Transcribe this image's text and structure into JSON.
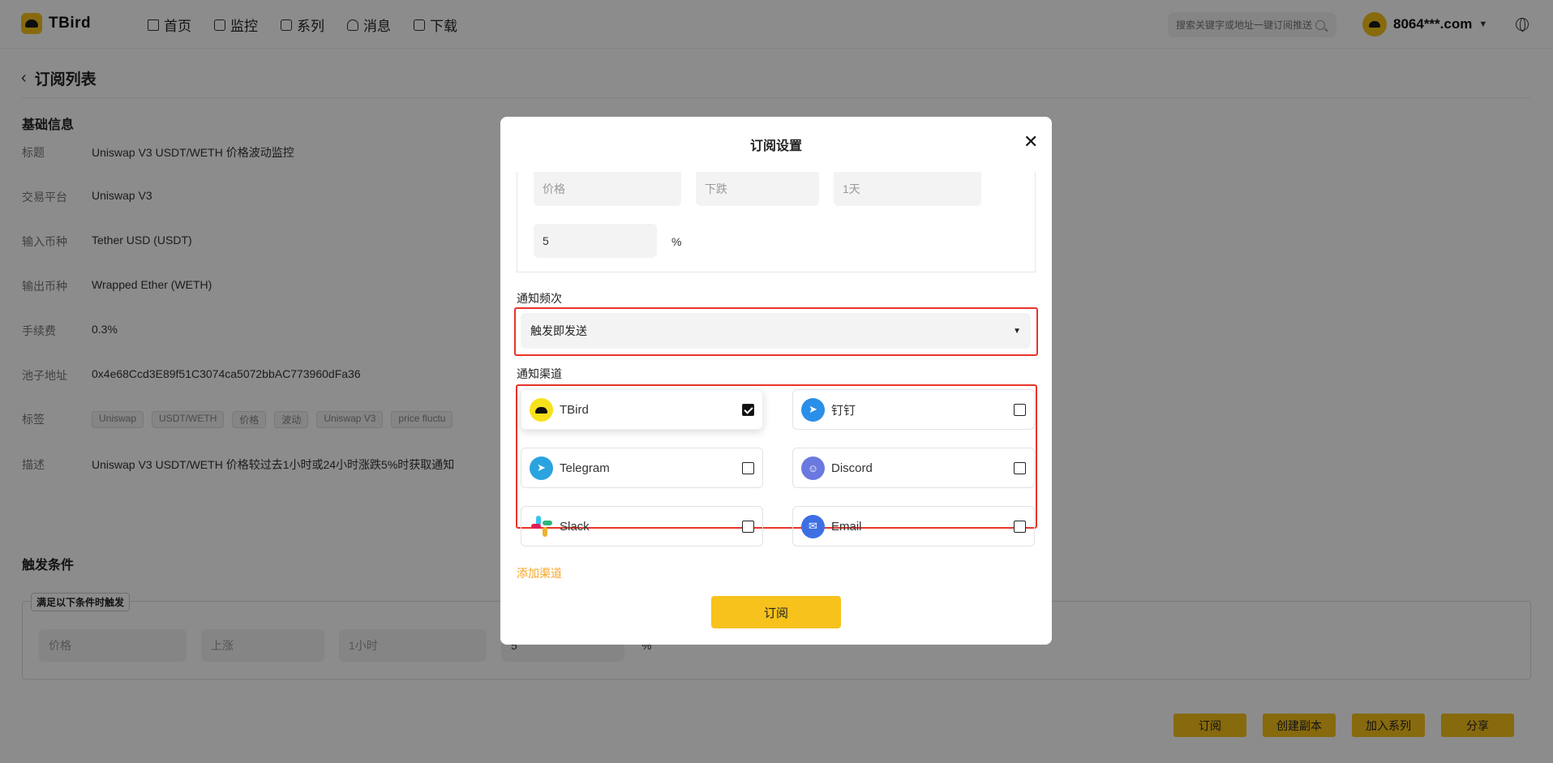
{
  "app": {
    "name": "TBird"
  },
  "nav": [
    {
      "label": "首页",
      "icon": "home-icon"
    },
    {
      "label": "监控",
      "icon": "monitor-icon"
    },
    {
      "label": "系列",
      "icon": "series-icon"
    },
    {
      "label": "消息",
      "icon": "bell-icon"
    },
    {
      "label": "下载",
      "icon": "download-icon"
    }
  ],
  "search": {
    "placeholder": "搜索关键字或地址一键订阅推送"
  },
  "account": {
    "name": "8064***.com"
  },
  "page": {
    "title": "订阅列表"
  },
  "basic": {
    "heading": "基础信息",
    "rows": [
      {
        "label": "标题",
        "value": "Uniswap V3 USDT/WETH 价格波动监控"
      },
      {
        "label": "交易平台",
        "value": "Uniswap V3"
      },
      {
        "label": "输入币种",
        "value": "Tether USD (USDT)"
      },
      {
        "label": "输出币种",
        "value": "Wrapped Ether (WETH)"
      },
      {
        "label": "手续费",
        "value": "0.3%"
      },
      {
        "label": "池子地址",
        "value": "0x4e68Ccd3E89f51C3074ca5072bbAC773960dFa36"
      }
    ],
    "tags_label": "标签",
    "tags": [
      "Uniswap",
      "USDT/WETH",
      "价格",
      "波动",
      "Uniswap V3",
      "price fluctu"
    ],
    "desc_label": "描述",
    "desc": "Uniswap V3 USDT/WETH 价格较过去1小时或24小时涨跌5%时获取通知"
  },
  "trigger": {
    "heading": "触发条件",
    "legend": "满足以下条件时触发",
    "fields": [
      "价格",
      "上涨",
      "1小时",
      "5"
    ],
    "unit": "%"
  },
  "actions": [
    "订阅",
    "创建副本",
    "加入系列",
    "分享"
  ],
  "modal": {
    "title": "订阅设置",
    "condition": {
      "fields": [
        "价格",
        "下跌",
        "1天"
      ],
      "value": "5",
      "unit": "%"
    },
    "frequency": {
      "label": "通知频次",
      "value": "触发即发送"
    },
    "channels": {
      "label": "通知渠道",
      "items": [
        {
          "name": "TBird",
          "checked": true
        },
        {
          "name": "钉钉",
          "checked": false
        },
        {
          "name": "Telegram",
          "checked": false
        },
        {
          "name": "Discord",
          "checked": false
        },
        {
          "name": "Slack",
          "checked": false
        },
        {
          "name": "Email",
          "checked": false
        }
      ]
    },
    "add_channel": "添加渠道",
    "submit": "订阅"
  }
}
